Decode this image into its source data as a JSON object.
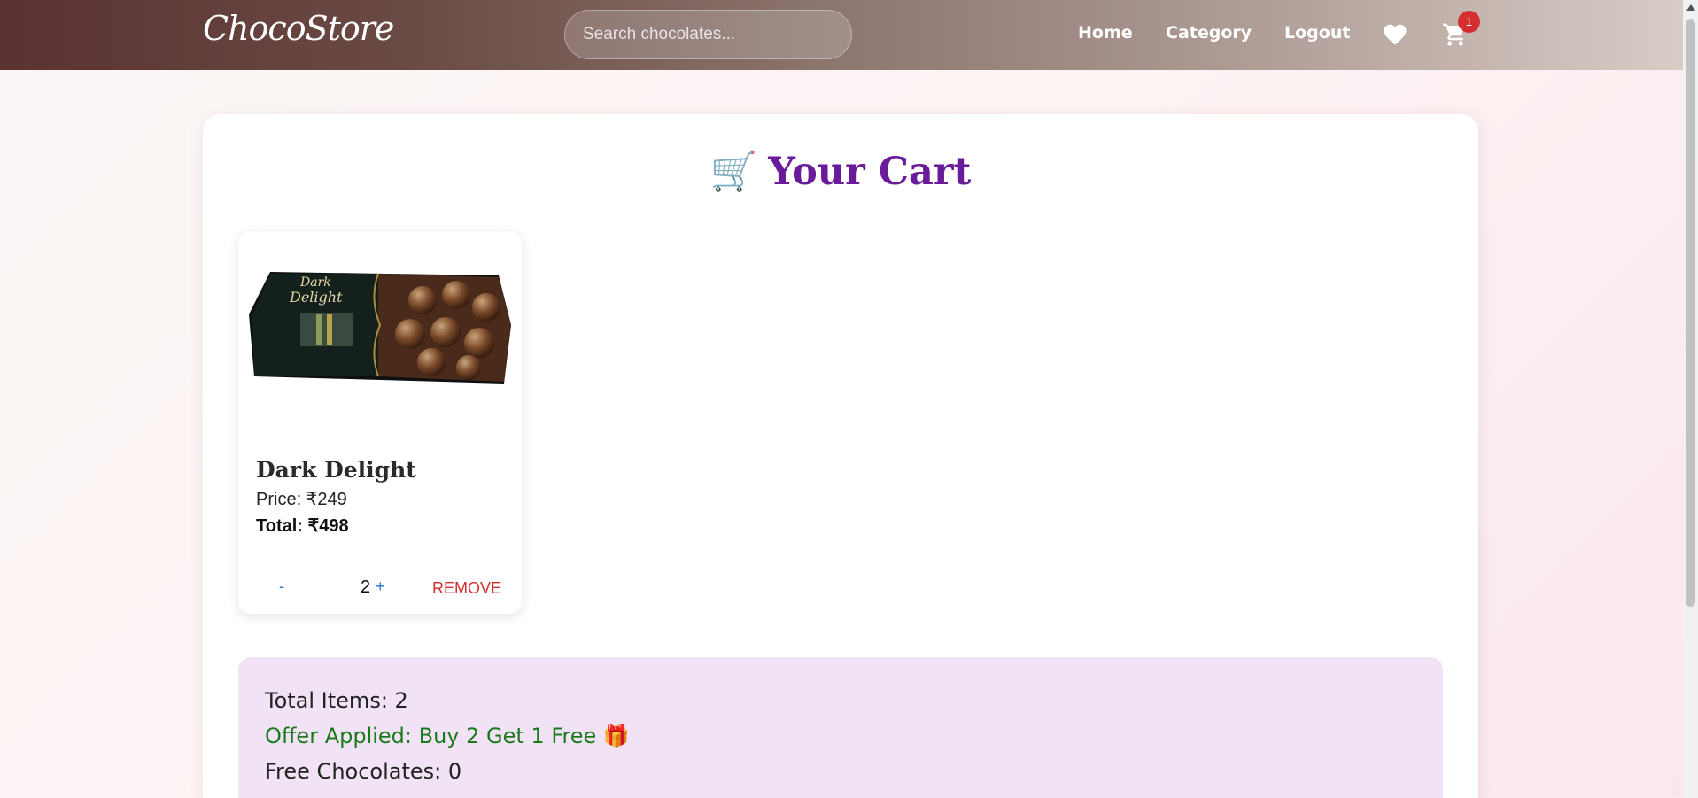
{
  "navbar": {
    "logo": "ChocoStore",
    "search_placeholder": "Search chocolates...",
    "links": {
      "home": "Home",
      "category": "Category",
      "logout": "Logout"
    },
    "icons": {
      "wishlist": "heart-icon",
      "cart": "cart-icon"
    },
    "cart_count": "1"
  },
  "cart": {
    "title": "Your Cart",
    "title_emoji": "🛒",
    "items": [
      {
        "name": "Dark Delight",
        "price": "Price: ₹249",
        "total": "Total: ₹498",
        "image_text_line1": "Dark",
        "image_text_line2": "Delight",
        "quantity": "2",
        "decrease_label": "-",
        "increase_label": "+",
        "remove_label": "REMOVE"
      }
    ],
    "summary": {
      "total_items": "Total Items: 2",
      "offer": "Offer Applied: Buy 2 Get 1 Free 🎁",
      "free_chocolates": "Free Chocolates: 0"
    }
  },
  "colors": {
    "title": "#6a1b9a",
    "offer": "#1b7a1b",
    "remove": "#d32f2f",
    "quantity_buttons": "#1976d2",
    "badge": "#d32f2f",
    "summary_background": "#f1e3f5"
  }
}
